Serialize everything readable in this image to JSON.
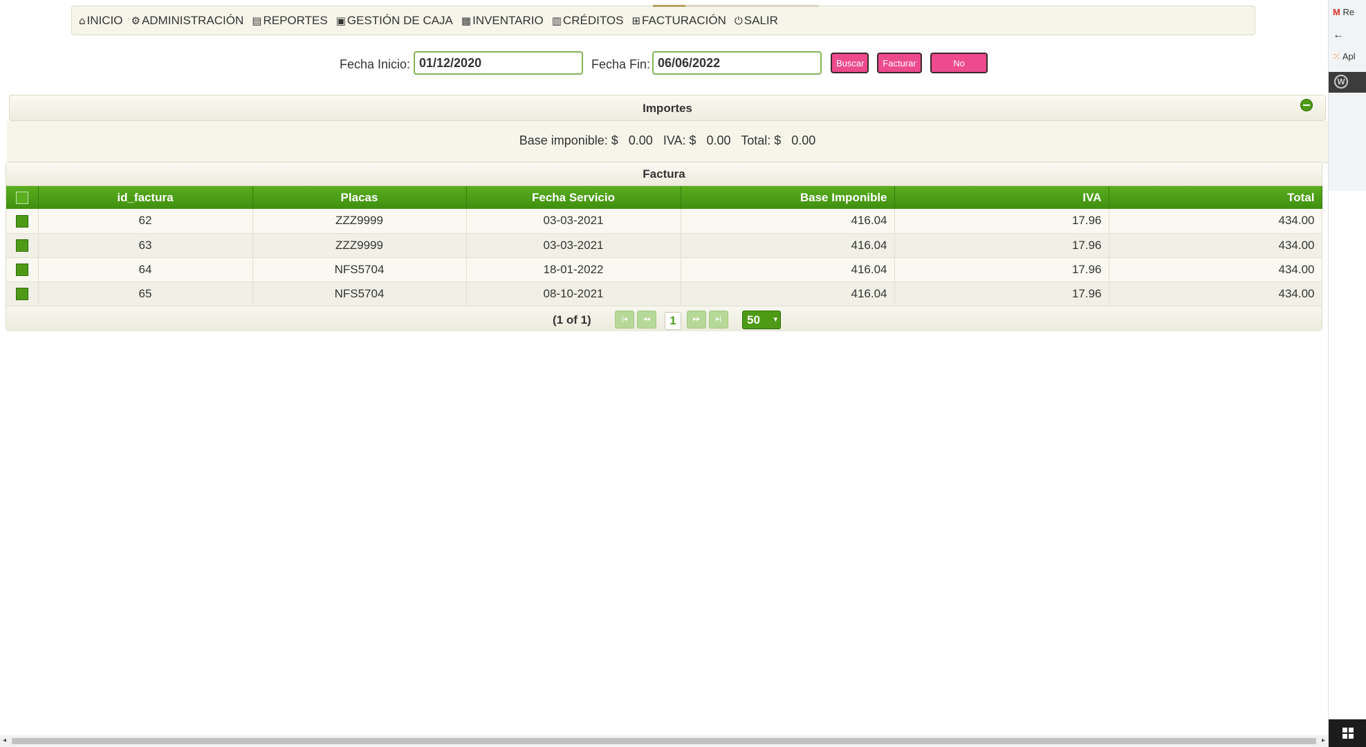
{
  "menu": {
    "items": [
      {
        "icon": "home-icon",
        "glyph": "⌂",
        "label": "INICIO"
      },
      {
        "icon": "gears-icon",
        "glyph": "⚙",
        "label": "ADMINISTRACIÓN"
      },
      {
        "icon": "document-icon",
        "glyph": "▤",
        "label": "REPORTES"
      },
      {
        "icon": "cash-register-icon",
        "glyph": "▣",
        "label": "GESTIÓN DE CAJA"
      },
      {
        "icon": "inventory-icon",
        "glyph": "▦",
        "label": "INVENTARIO"
      },
      {
        "icon": "book-icon",
        "glyph": "▥",
        "label": "CRÉDITOS"
      },
      {
        "icon": "grid-icon",
        "glyph": "⊞",
        "label": "FACTURACIÓN"
      },
      {
        "icon": "power-icon",
        "glyph": "⏻",
        "label": "SALIR"
      }
    ]
  },
  "filter": {
    "start_label": "Fecha Inicio:",
    "start_value": "01/12/2020",
    "end_label": "Fecha Fin:",
    "end_value": "06/06/2022",
    "search_button": "Buscar",
    "invoice_button": "Facturar",
    "no_invoice_button": "No Facturar"
  },
  "importes": {
    "title": "Importes",
    "summary": "Base imponible: $   0.00   IVA: $   0.00   Total: $   0.00"
  },
  "table": {
    "caption": "Factura",
    "columns": [
      "id_factura",
      "Placas",
      "Fecha Servicio",
      "Base Imponible",
      "IVA",
      "Total"
    ],
    "rows": [
      {
        "id": "62",
        "placas": "ZZZ9999",
        "fecha": "03-03-2021",
        "base": "416.04",
        "iva": "17.96",
        "total": "434.00"
      },
      {
        "id": "63",
        "placas": "ZZZ9999",
        "fecha": "03-03-2021",
        "base": "416.04",
        "iva": "17.96",
        "total": "434.00"
      },
      {
        "id": "64",
        "placas": "NFS5704",
        "fecha": "18-01-2022",
        "base": "416.04",
        "iva": "17.96",
        "total": "434.00"
      },
      {
        "id": "65",
        "placas": "NFS5704",
        "fecha": "08-10-2021",
        "base": "416.04",
        "iva": "17.96",
        "total": "434.00"
      }
    ]
  },
  "pager": {
    "status": "(1 of 1)",
    "current_page": "1",
    "rows_per_page": "50",
    "first_glyph": "|◂",
    "prev_glyph": "◂◂",
    "next_glyph": "▸▸",
    "last_glyph": "▸|"
  },
  "side": {
    "tab_text": "Re",
    "apps_text": "Apl"
  },
  "colors": {
    "accent_green": "#4e9a16",
    "button_pink": "#ee4a8e",
    "panel_bg": "#f6f5ea"
  }
}
